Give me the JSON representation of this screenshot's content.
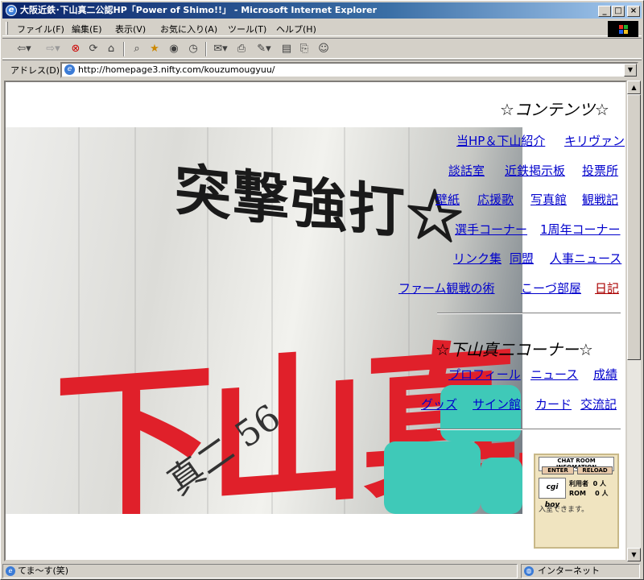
{
  "window": {
    "title": "大阪近鉄･下山真二公認HP「Power of Shimo!!」 - Microsoft Internet Explorer",
    "minimize": "_",
    "maximize": "□",
    "close": "×"
  },
  "menu": {
    "items": [
      "ファイル(F)",
      "編集(E)",
      "表示(V)",
      "お気に入り(A)",
      "ツール(T)",
      "ヘルプ(H)"
    ]
  },
  "address": {
    "label": "アドレス(D)",
    "url": "http://homepage3.nifty.com/kouzumougyuu/"
  },
  "contents": {
    "title": "☆コンテンツ☆",
    "rows": [
      [
        "当HP＆下山紹介",
        "キリヴァン"
      ],
      [
        "談話室",
        "近鉄掲示板",
        "投票所"
      ],
      [
        "壁紙",
        "応援歌",
        "写真館",
        "観戦記"
      ],
      [
        "選手コーナー",
        "1周年コーナー"
      ],
      [
        "リンク集",
        "同盟",
        "人事ニュース"
      ],
      [
        "ファーム観戦の術",
        "こーづ部屋",
        "日記"
      ]
    ]
  },
  "corner": {
    "title": "☆下山真二コーナー☆",
    "rows": [
      [
        "プロフィール",
        "ニュース",
        "成績"
      ],
      [
        "グッズ",
        "サイン館",
        "カード",
        "交流記"
      ]
    ]
  },
  "photo": {
    "banner_title": "突撃強打☆",
    "banner_name": "下山真二",
    "signature": "真二 56"
  },
  "chat": {
    "header": "CHAT ROOM INFOMATION",
    "enter": "ENTER",
    "reload": "RELOAD",
    "logo": "cgi boy",
    "label_users": "利用者",
    "users": "0",
    "label_rom": "ROM",
    "rom": "0",
    "unit": "人",
    "status": "入室できます。"
  },
  "status": {
    "left": "てま～す(笑)",
    "zone": "インターネット"
  }
}
